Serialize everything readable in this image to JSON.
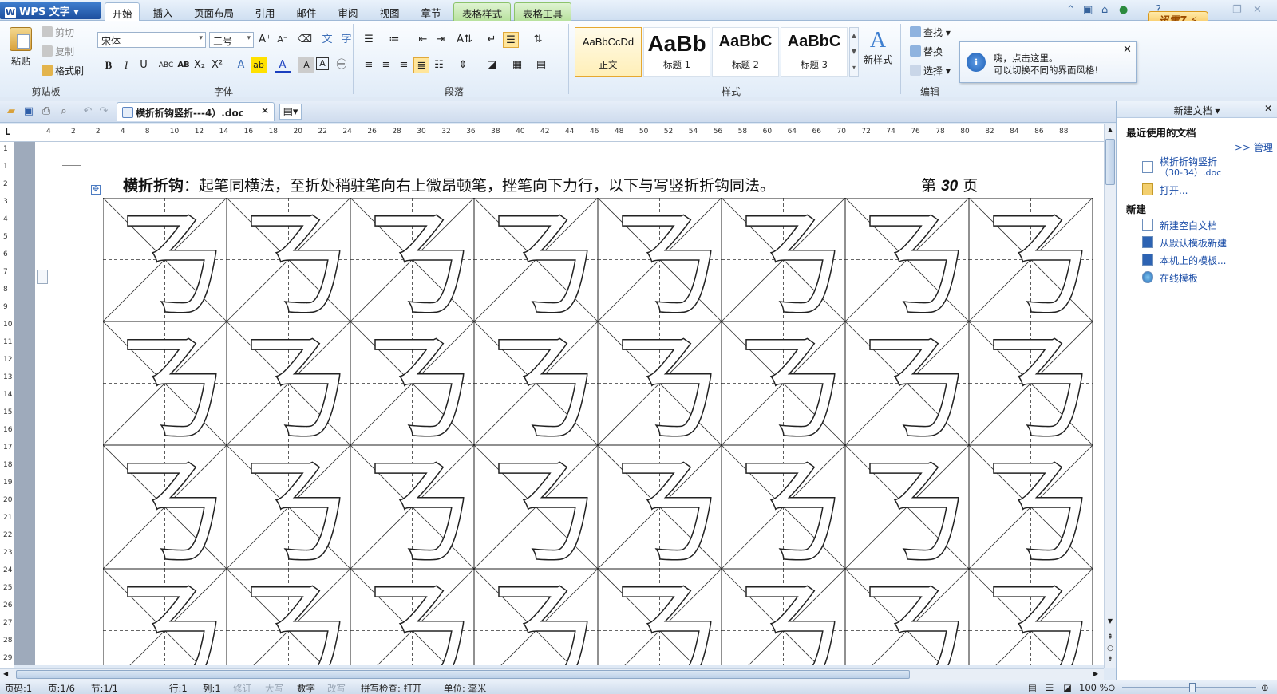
{
  "app": {
    "name": "WPS 文字"
  },
  "menu_tabs": [
    {
      "label": "开始",
      "active": true
    },
    {
      "label": "插入"
    },
    {
      "label": "页面布局"
    },
    {
      "label": "引用"
    },
    {
      "label": "邮件"
    },
    {
      "label": "审阅"
    },
    {
      "label": "视图"
    },
    {
      "label": "章节"
    },
    {
      "label": "表格样式",
      "contextual": true
    },
    {
      "label": "表格工具",
      "contextual": true
    }
  ],
  "xunlei_badge": "迅雷7",
  "ribbon": {
    "clipboard": {
      "paste": "粘贴",
      "cut": "剪切",
      "copy": "复制",
      "format_painter": "格式刷",
      "group_label": "剪贴板"
    },
    "font": {
      "font_name": "宋体",
      "font_size": "三号",
      "group_label": "字体"
    },
    "paragraph": {
      "group_label": "段落"
    },
    "styles": {
      "items": [
        {
          "preview": "AaBbCcDd",
          "name": "正文",
          "selected": true
        },
        {
          "preview": "AaBb",
          "name": "标题 1"
        },
        {
          "preview": "AaBbC",
          "name": "标题 2"
        },
        {
          "preview": "AaBbC",
          "name": "标题 3"
        }
      ],
      "new_style": "新样式",
      "group_label": "样式"
    },
    "edit": {
      "find": "查找",
      "replace": "替换",
      "select": "选择",
      "group_label": "编辑"
    }
  },
  "tooltip": {
    "line1": "嗨，点击这里。",
    "line2": "可以切换不同的界面风格!"
  },
  "doc_tab": {
    "title": "横折折钩竖折---4）.doc"
  },
  "ruler": {
    "h_numbers": [
      "4",
      "2",
      "2",
      "4",
      "8",
      "10",
      "12",
      "14",
      "16",
      "18",
      "20",
      "22",
      "24",
      "26",
      "28",
      "30",
      "32",
      "36",
      "38",
      "40",
      "42",
      "44",
      "46",
      "48",
      "50",
      "52",
      "54",
      "56",
      "58",
      "60",
      "64",
      "66",
      "70",
      "72",
      "74",
      "76",
      "78",
      "80",
      "82",
      "84",
      "86",
      "88"
    ],
    "v_numbers": [
      "1",
      "1",
      "2",
      "3",
      "4",
      "5",
      "6",
      "7",
      "8",
      "9",
      "10",
      "11",
      "12",
      "13",
      "14",
      "15",
      "16",
      "17",
      "18",
      "19",
      "20",
      "21",
      "22",
      "23",
      "24",
      "25",
      "26",
      "27",
      "28",
      "29"
    ]
  },
  "document": {
    "title_bold": "横折折钩",
    "title_rest": "：起笔同横法，至折处稍驻笔向右上微昂顿笔，挫笔向下力行，以下与写竖折折钩同法。",
    "page_prefix": "第",
    "page_number": "30",
    "page_suffix": "页",
    "grid": {
      "columns": 8,
      "rows": 4,
      "character": "ㄋ"
    }
  },
  "task_pane": {
    "header": "新建文档",
    "recent_title": "最近使用的文档",
    "manage": ">> 管理",
    "recent_file_line1": "横折折钩竖折",
    "recent_file_line2": "（30-34）.doc",
    "open": "打开...",
    "new_title": "新建",
    "new_blank": "新建空白文档",
    "from_default": "从默认模板新建",
    "local_template": "本机上的模板...",
    "online_template": "在线模板"
  },
  "status_bar": {
    "page_code": "页码:1",
    "page": "页:1/6",
    "section": "节:1/1",
    "row": "行:1",
    "col": "列:1",
    "revise": "修订",
    "caps": "大写",
    "num": "数字",
    "overwrite": "改写",
    "spellcheck": "拼写检查: 打开",
    "unit": "单位: 毫米",
    "zoom": "100 %"
  },
  "colors": {
    "accent": "#1d4f9e",
    "ribbon_bg": "#e1ecf8",
    "link": "#1d4fa8",
    "contextual_tab": "#b8e29e"
  }
}
